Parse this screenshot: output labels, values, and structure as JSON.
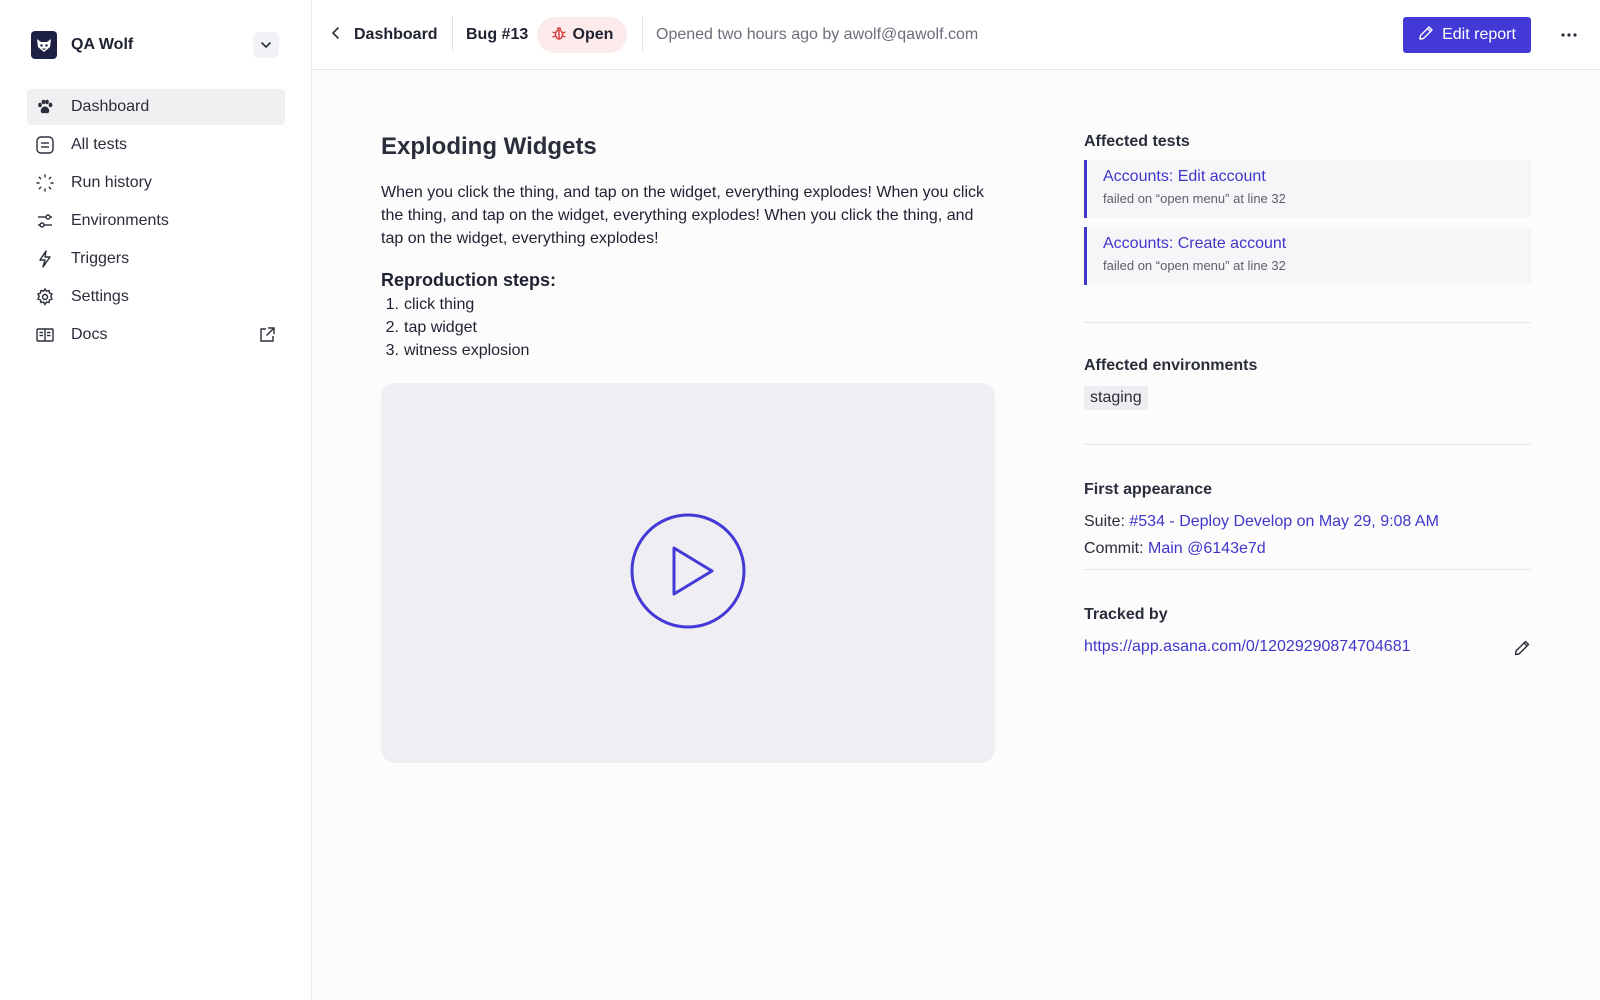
{
  "sidebar": {
    "brand": "QA Wolf",
    "items": [
      {
        "label": "Dashboard",
        "icon": "paw-icon",
        "active": true
      },
      {
        "label": "All tests",
        "icon": "list-icon"
      },
      {
        "label": "Run history",
        "icon": "loading-dots-icon"
      },
      {
        "label": "Environments",
        "icon": "sliders-icon"
      },
      {
        "label": "Triggers",
        "icon": "lightning-icon"
      },
      {
        "label": "Settings",
        "icon": "gear-icon"
      },
      {
        "label": "Docs",
        "icon": "book-icon",
        "external": true
      }
    ]
  },
  "header": {
    "back_label": "Dashboard",
    "bug_id": "Bug #13",
    "status": "Open",
    "opened_text": "Opened two hours ago by awolf@qawolf.com",
    "edit_label": "Edit report"
  },
  "report": {
    "title": "Exploding Widgets",
    "description": "When you click the thing, and tap on the widget, everything explodes! When you click the thing, and tap on the widget, everything explodes! When you click the thing, and tap on the widget, everything explodes!",
    "steps_title": "Reproduction steps:",
    "steps": [
      "click thing",
      "tap widget",
      "witness explosion"
    ]
  },
  "affected_tests": {
    "title": "Affected tests",
    "items": [
      {
        "name": "Accounts: Edit account",
        "detail": "failed on “open menu” at line 32"
      },
      {
        "name": "Accounts: Create account",
        "detail": "failed on “open menu” at line 32"
      }
    ]
  },
  "affected_environments": {
    "title": "Affected environments",
    "items": [
      "staging"
    ]
  },
  "first_appearance": {
    "title": "First appearance",
    "suite_label": "Suite:",
    "suite_value": "#534 - Deploy Develop on May 29, 9:08 AM",
    "commit_label": "Commit:",
    "commit_value": "Main @6143e7d"
  },
  "tracked_by": {
    "title": "Tracked by",
    "url": "https://app.asana.com/0/12029290874704681"
  },
  "colors": {
    "accent": "#4339d6",
    "link": "#3f37c9",
    "status_bg": "#fdeaea",
    "status_icon": "#d23b3b"
  }
}
